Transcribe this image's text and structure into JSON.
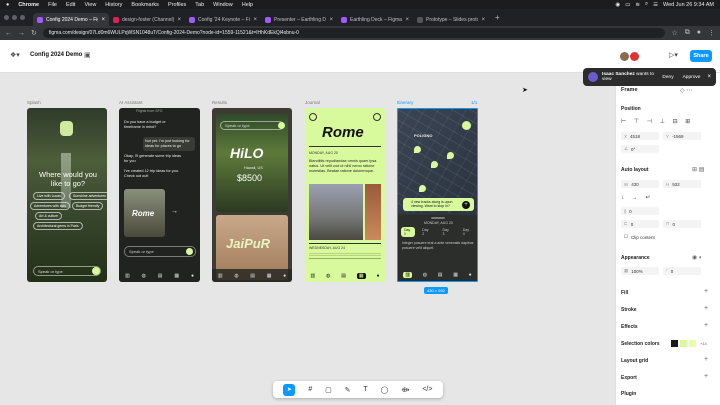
{
  "menubar": {
    "apple": "",
    "items": [
      "Chrome",
      "File",
      "Edit",
      "View",
      "History",
      "Bookmarks",
      "Profiles",
      "Tab",
      "Window",
      "Help"
    ],
    "datetime": "Wed Jun 26 9:34 AM"
  },
  "tabs": [
    {
      "title": "Config 2024 Demo – Figma",
      "active": true
    },
    {
      "title": "design-foster (Channel) – U...",
      "active": false
    },
    {
      "title": "Config '24 Keynote – Figma",
      "active": false
    },
    {
      "title": "Presenter – Earthling Deck –",
      "active": false
    },
    {
      "title": "Earthling Deck – Figma",
      "active": false
    },
    {
      "title": "Prototype – Slides prototype",
      "active": false
    }
  ],
  "address": {
    "url": "figma.com/design/07Ld0m6WULPqWSN1048uT/Config-2024-Demo?node-id=1559-11521&t=IHhKdEkQl4sbnu-0"
  },
  "figma": {
    "project": "Config 2024 Demo",
    "share_label": "Share",
    "zoom": ""
  },
  "notification": {
    "name": "Isaac Sanchez",
    "message": "Isaac Sanchez wants to view",
    "deny": "Deny",
    "approve": "Approve"
  },
  "canvas": {
    "frame_labels": [
      "Splash",
      "AI Assistant",
      "Results",
      "Journal",
      "Itinerary"
    ],
    "itinerary_count": "1/1",
    "selection_size": "430 × 932",
    "splash": {
      "question": "Where would you like to go?",
      "chips": [
        "Live with Lucas",
        "Sunshine adventures",
        "Adventures with kids",
        "Budget friendly",
        "Art & culture",
        "Architectural gems in Paris"
      ],
      "input_placeholder": "Speak or type"
    },
    "assistant": {
      "header": "Flights from SFO",
      "msg1": "Do you have a budget or timeframe in mind?",
      "msg2": "Not yet. I'm just looking for ideas for places to go",
      "msg3": "Okay, I'll generate some trip ideas for you",
      "msg4": "I've created 12 trip ideas for you. Check out out!",
      "card_title": "Rome",
      "input_placeholder": "Speak or type"
    },
    "results": {
      "input_placeholder": "Speak or type",
      "card1_title": "HiLO",
      "card1_sub": "Hawaii, US",
      "card1_price": "$8500",
      "card2_title": "JaiPuR"
    },
    "journal": {
      "title": "Rome",
      "date1": "MONDAY, AUG 20",
      "entry1": "Blandittis repudiandae omnis quam ipsa natus. Ut velit cod ut nihil nemo ratione molestias. Beatae ratione doloremque.",
      "date2": "WEDNESDAY, AUG 24"
    },
    "itinerary": {
      "map_label": "POLIGNO",
      "banner": "4 new tracks along is upon viewing. Want to stop in?",
      "day": "MONDAY, AUG 20",
      "tabs": [
        "Day 1",
        "Day 2",
        "Day 3",
        "Day 4"
      ],
      "text": "Integer posuere erat a ante venenatis dapibus posuere velit aliquet."
    }
  },
  "panel": {
    "frame_label": "Frame",
    "position_label": "Position",
    "x": "4518",
    "y": "-1569",
    "rotation": "0°",
    "autolayout_label": "Auto layout",
    "w": "430",
    "h": "932",
    "gap": "0",
    "pad_h": "0",
    "pad_v": "0",
    "clip": "Clip content",
    "appearance_label": "Appearance",
    "opacity": "100%",
    "radius": "0",
    "fill_label": "Fill",
    "stroke_label": "Stroke",
    "effects_label": "Effects",
    "selection_colors_label": "Selection colors",
    "selection_colors_extra": "+14",
    "layout_grid_label": "Layout grid",
    "export_label": "Export",
    "plugin_label": "Plugin",
    "colors": {
      "dark": "#1a1a1a",
      "lime": "#d9f99d",
      "lime2": "#e7ffa9"
    }
  }
}
